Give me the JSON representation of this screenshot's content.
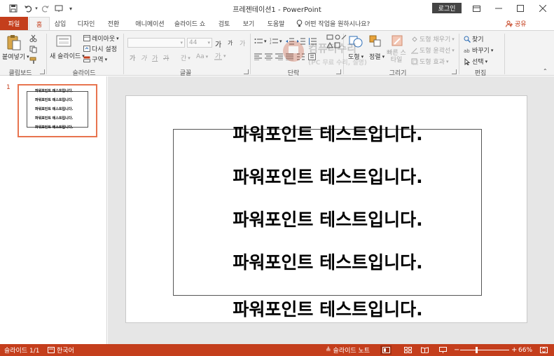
{
  "titlebar": {
    "doc_title": "프레젠테이션1 - PowerPoint",
    "login_label": "로그인",
    "icons": [
      "save-icon",
      "undo-icon",
      "redo-icon",
      "customize-qat-icon",
      "ribbon-display-icon",
      "minimize-icon",
      "maximize-icon",
      "close-icon"
    ]
  },
  "tabs": {
    "file": "파일",
    "items": [
      "홈",
      "삽입",
      "디자인",
      "전환",
      "애니메이션",
      "슬라이드 쇼",
      "검토",
      "보기",
      "도움말"
    ],
    "active": "홈",
    "tell_me": "어떤 작업을 원하시나요?",
    "share": "공유"
  },
  "ribbon": {
    "clipboard": {
      "paste": "붙여넣기",
      "label": "클립보드"
    },
    "slides": {
      "new_slide": "새 슬라이드",
      "layout": "레이아웃",
      "reset": "다시 설정",
      "section": "구역",
      "label": "슬라이드"
    },
    "font": {
      "font_name": "",
      "font_size": "44",
      "bold": "가",
      "italic": "가",
      "underline": "가",
      "strike": "가",
      "char_spacing": "간",
      "case": "Aa",
      "grow": "가",
      "shrink": "가",
      "clear": "가",
      "label": "글꼴"
    },
    "paragraph": {
      "label": "단락"
    },
    "drawing": {
      "shapes": "도형",
      "arrange": "정렬",
      "quick_styles": "빠른 스타일",
      "fill": "도형 채우기",
      "outline": "도형 윤곽선",
      "effects": "도형 효과",
      "label": "그리기"
    },
    "editing": {
      "find": "찾기",
      "replace": "바꾸기",
      "select": "선택",
      "label": "편집"
    }
  },
  "watermark": {
    "line1": "컴퓨터수리",
    "line2": "(PC 무료 수리, 설명)"
  },
  "slides_panel": {
    "slide_number": "1",
    "thumb_lines": [
      "파워포인트 테스트입니다.",
      "파워포인트 테스트입니다.",
      "파워포인트 테스트입니다.",
      "파워포인트 테스트입니다.",
      "파워포인트 테스트입니다."
    ]
  },
  "slide": {
    "lines": [
      "파워포인트 테스트입니다.",
      "파워포인트 테스트입니다.",
      "파워포인트 테스트입니다.",
      "파워포인트 테스트입니다.",
      "파워포인트 테스트입니다."
    ]
  },
  "statusbar": {
    "slide_info": "슬라이드 1/1",
    "language": "한국어",
    "notes": "슬라이드 노트",
    "zoom": "66%",
    "zoom_fraction": 0.33,
    "accent": "#c43e1c"
  }
}
